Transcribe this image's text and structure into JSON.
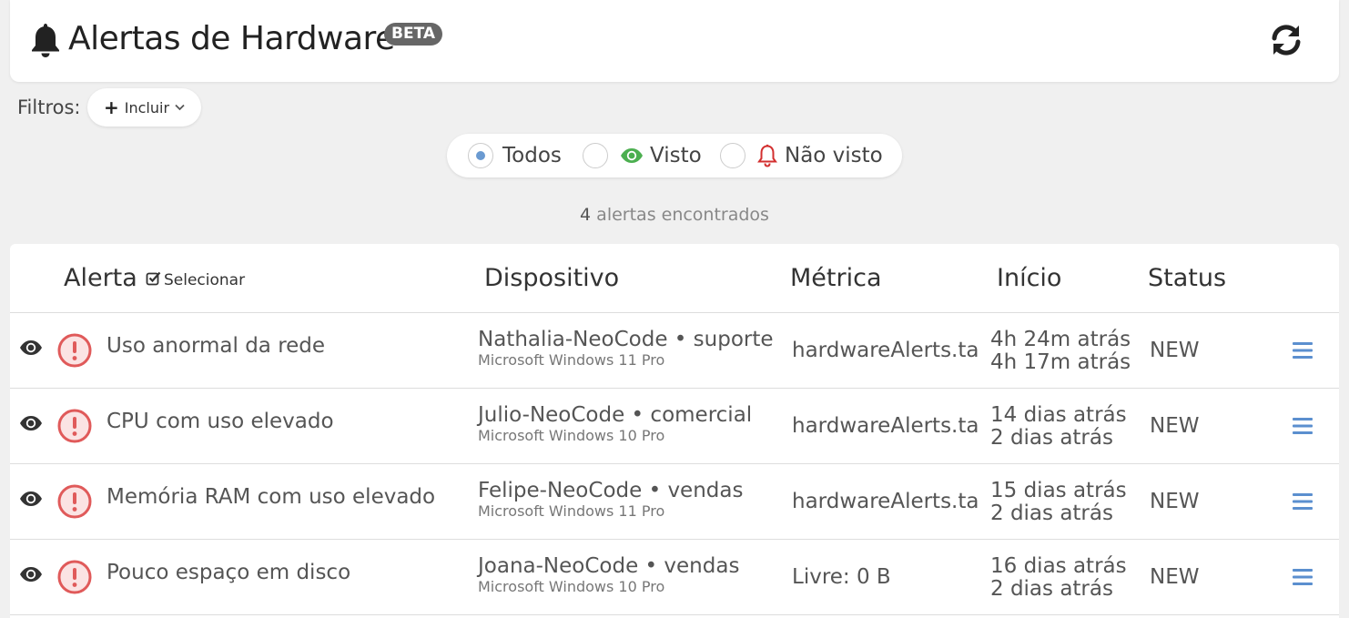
{
  "header": {
    "title": "Alertas de Hardware",
    "badge": "BETA",
    "title_icon": "bell-icon",
    "refresh_icon": "refresh-icon"
  },
  "filters": {
    "label": "Filtros:",
    "include_label": "Incluir"
  },
  "view_filter": {
    "options": [
      {
        "label": "Todos",
        "selected": true
      },
      {
        "label": "Visto",
        "icon": "eye-icon",
        "icon_color": "#4caf50"
      },
      {
        "label": "Não visto",
        "icon": "bell-outline-icon",
        "icon_color": "#d32f2f"
      }
    ]
  },
  "summary": {
    "count": "4",
    "text": "alertas encontrados"
  },
  "table": {
    "columns": {
      "alert": "Alerta",
      "select": "Selecionar",
      "device": "Dispositivo",
      "metric": "Métrica",
      "start": "Início",
      "status": "Status"
    },
    "rows": [
      {
        "alert": "Uso anormal da rede",
        "device": "Nathalia-NeoCode • suporte",
        "os": "Microsoft Windows 11 Pro",
        "metric": "hardwareAlerts.table.metricas.rede",
        "start": "4h 24m atrás",
        "end": "4h 17m atrás",
        "status": "NEW"
      },
      {
        "alert": "CPU com uso elevado",
        "device": "Julio-NeoCode • comercial",
        "os": "Microsoft Windows 10 Pro",
        "metric": "hardwareAlerts.table.metricas.cpu",
        "start": "14 dias atrás",
        "end": "2 dias atrás",
        "status": "NEW"
      },
      {
        "alert": "Memória RAM com uso elevado",
        "device": "Felipe-NeoCode • vendas",
        "os": "Microsoft Windows 11 Pro",
        "metric": "hardwareAlerts.table.metricas.memoria",
        "start": "15 dias atrás",
        "end": "2 dias atrás",
        "status": "NEW"
      },
      {
        "alert": "Pouco espaço em disco",
        "device": "Joana-NeoCode • vendas",
        "os": "Microsoft Windows 10 Pro",
        "metric": "Livre: 0 B",
        "start": "16 dias atrás",
        "end": "2 dias atrás",
        "status": "NEW"
      }
    ]
  },
  "colors": {
    "accent": "#5b8fcf",
    "alert_red": "#e05a5a",
    "seen_green": "#4caf50",
    "unseen_red": "#d32f2f"
  }
}
